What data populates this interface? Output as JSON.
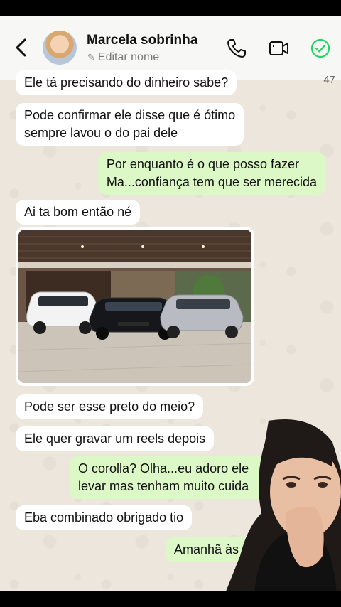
{
  "header": {
    "contact_name": "Marcela sobrinha",
    "edit_name_label": "Editar nome",
    "unread_count": "47"
  },
  "messages": [
    {
      "direction": "in",
      "lines": [
        "Ele tá precisando do dinheiro sabe?"
      ]
    },
    {
      "direction": "in",
      "lines": [
        "Pode confirmar ele disse que é ótimo",
        "sempre lavou o do pai dele"
      ]
    },
    {
      "direction": "out",
      "lines": [
        "Por enquanto é o que posso fazer",
        "Ma...confiança tem que ser merecida"
      ]
    },
    {
      "direction": "in",
      "lines": [
        "Ai ta bom então né"
      ]
    },
    {
      "direction": "in",
      "type": "image",
      "content": "photo-of-three-cars"
    },
    {
      "direction": "in",
      "lines": [
        "Pode ser esse preto do meio?"
      ]
    },
    {
      "direction": "in",
      "lines": [
        "Ele quer gravar um reels depois"
      ]
    },
    {
      "direction": "out",
      "lines": [
        "O corolla? Olha...eu adoro ele",
        "levar mas tenham muito cuida"
      ]
    },
    {
      "direction": "in",
      "lines": [
        "Eba combinado obrigado tio"
      ]
    },
    {
      "direction": "out",
      "lines": [
        "Amanhã às"
      ]
    }
  ],
  "colors": {
    "header_bg": "#f7f8f6",
    "chat_bg": "#ece6dc",
    "incoming_bubble": "#ffffff",
    "outgoing_bubble": "#dcf8c6",
    "accent_green": "#25d366"
  },
  "icons": [
    "back-arrow-icon",
    "pencil-icon",
    "phone-icon",
    "video-camera-icon",
    "verified-check-icon"
  ]
}
